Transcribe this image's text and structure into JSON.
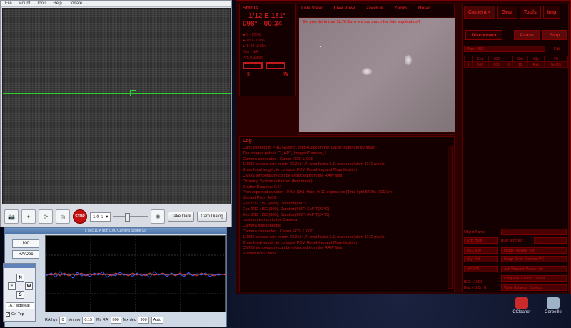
{
  "phd": {
    "menu": [
      "File",
      "Mount",
      "Tools",
      "Help",
      "Donate"
    ],
    "exposure": "1.0 s",
    "take_dark": "Take Dark",
    "cam_dialog": "Cam Dialog",
    "stop_label": "STOP"
  },
  "graph": {
    "title": "5 sec/10 A dot: 0.00   Camera   Scope   Co",
    "btn_100": "100",
    "btn_radec": "RA/Dec",
    "btn_0": "0",
    "n": "N",
    "e": "E",
    "w": "W",
    "s": "S",
    "speed": "16.* sidereal",
    "on_top": "On Top",
    "ra_hys_label": "RA hys",
    "ra_hys": "0",
    "mn_mo_label": "Mn mo",
    "mn_mo": "0.15",
    "mx_ra_label": "Mx RA",
    "mx_ra": "800",
    "mx_dec_label": "Mx dec",
    "mx_dec": "900",
    "auto": "Auto"
  },
  "apt": {
    "status": {
      "title": "Status",
      "ra": "1/12 E 181°",
      "time": "098° - 00:34",
      "l1": "▶ 0 - 100%",
      "l2": "▶ 100 - 100%",
      "l3": "▶ 1+21 Ul Min",
      "l4": "filter : N/A",
      "l5": "PHD Guiding",
      "val": "9",
      "w": "W"
    },
    "liveview": {
      "tabs": [
        "Live View",
        "Live View",
        "Zoom ×",
        "Zoom"
      ],
      "reset": "Reset",
      "msg": "Do you think that 11.70 Euro are too much for this application?"
    },
    "right": {
      "tabs": [
        "Camera ×",
        "Gear",
        "Tools",
        "Img"
      ],
      "disconnect": "Disconnect",
      "pause": "Pause",
      "stop": "Stop",
      "plan": "Plan : M66",
      "edit": "Edit",
      "headers": [
        "",
        "Exp",
        "ISO",
        "",
        "Cnt",
        "Qty",
        "Fit"
      ],
      "row": [
        "1",
        "600",
        "800",
        "0",
        "12",
        "RxL",
        "NoCfit"
      ],
      "object_name": "Object Name",
      "dark_seconds": "Bulb seconds :",
      "exp_bulb": "Exp: Bulb",
      "iso": "ISO: 800",
      "qty": "Qty: RxL",
      "av": "AV: N/A",
      "img_preview": "Image Preview : On",
      "img_dest": "Image Dest: Camera+PC",
      "anti_vib": "Anti Vibration Pause : 0s",
      "long_exp": "Long Exp. Control : Virtual",
      "white_bal": "White Balance : Daylight",
      "iso_small": "ISO: 11060",
      "bias": "Bias # 0 Dr: #b"
    },
    "log": {
      "title": "Log",
      "lines": [
        "Can't connect to PHD Guiding. Shift+Click on the 'Guide' button to try again.",
        "The images path is C:_APT_Images\\Camera_1",
        "Camera connected : Canon EOS 1100D",
        "1100D: sensor size in mm 22.2x14.7, crop factor 1.6, max resolution 4272 pixels",
        "Enter focal length, to compute FOV, Resolving and Magnification",
        "CMOS temperature can be extracted from the RAW files",
        "Dithering System initialized (free mode).",
        "Shutter Duration: 0.67",
        "Plan expected duration : 840s (1h1.4min) in 12 exposures [Total light 8400s (100.0m",
        "Started Plan : M66",
        "Exp 1/12 : ISO(800), Duration(600\")",
        "Exp 2/12 : ISO(800), Duration(600\") ExP T(22°C)",
        "Exp 3/12 : ISO(800), Duration(600\") ExP T(24°C)",
        "Lost connection to the Camera",
        "Camera disconnected",
        "Camera connected : Canon EOS 1100D",
        "1100D: sensor size in mm 22.2x14.7, crop factor 1.6, max resolution 4272 pixels",
        "Enter focal length, to compute FOV, Resolving and Magnification",
        "CMOS temperature can be extracted from the RAW files",
        "Started Plan : M66"
      ]
    }
  },
  "desktop": {
    "icons": [
      "CCleaner",
      "Corbeille"
    ]
  }
}
